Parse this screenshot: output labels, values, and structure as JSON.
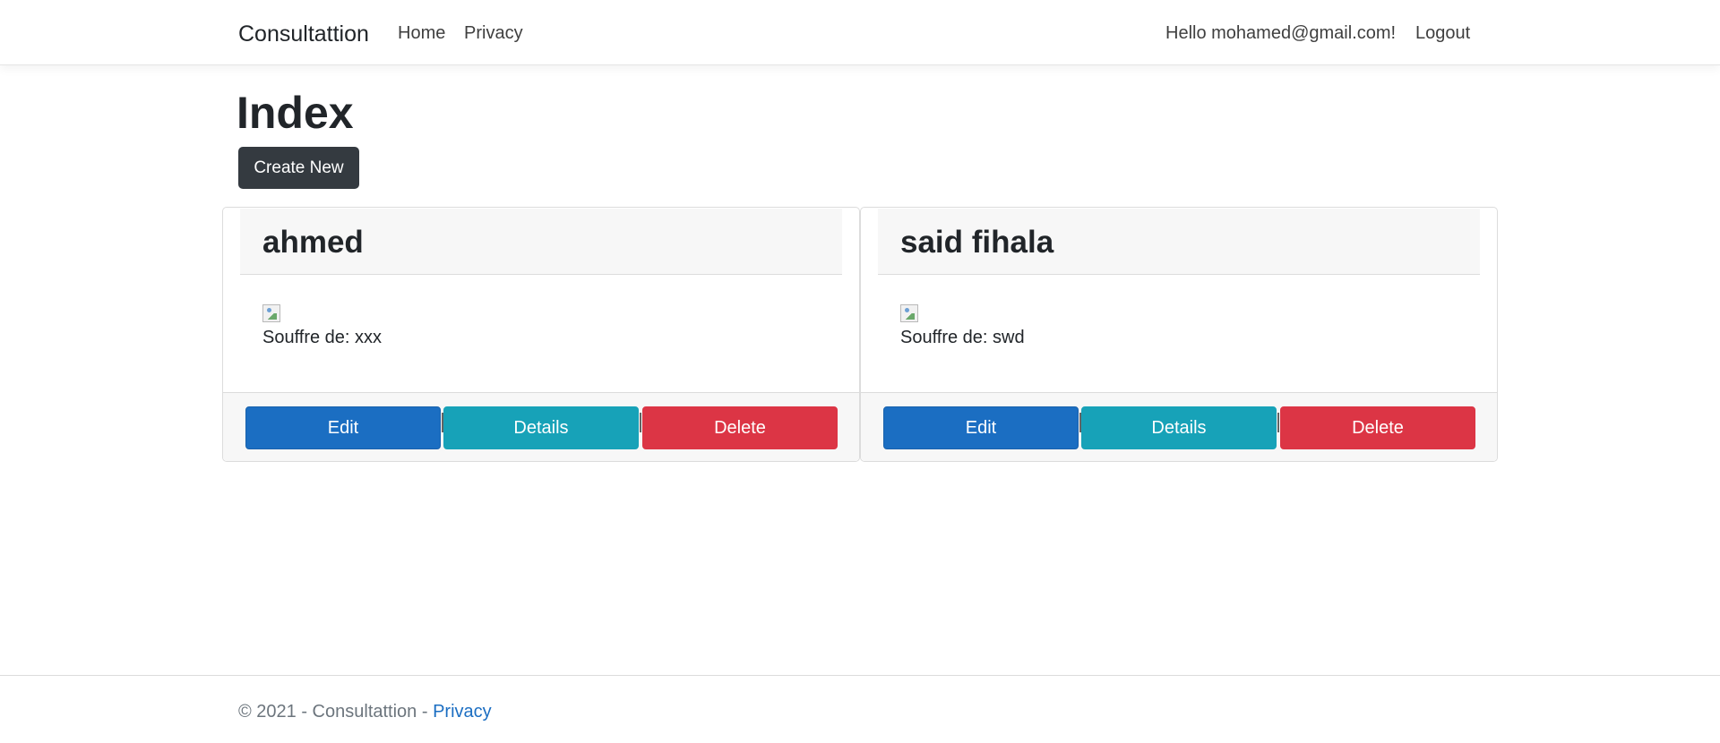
{
  "navbar": {
    "brand": "Consultattion",
    "links": [
      "Home",
      "Privacy"
    ],
    "greeting": "Hello mohamed@gmail.com!",
    "logout": "Logout"
  },
  "page": {
    "title": "Index",
    "create_button": "Create New"
  },
  "cards": [
    {
      "name": "ahmed",
      "description": "Souffre de: xxx",
      "edit": "Edit",
      "details": "Details",
      "delete": "Delete"
    },
    {
      "name": "said fihala",
      "description": "Souffre de: swd",
      "edit": "Edit",
      "details": "Details",
      "delete": "Delete"
    }
  ],
  "footer": {
    "copyright": "© 2021 - Consultattion - ",
    "privacy_link": "Privacy"
  },
  "colors": {
    "primary": "#1b6ec2",
    "info": "#17a2b8",
    "danger": "#dc3545",
    "dark": "#343a40"
  }
}
